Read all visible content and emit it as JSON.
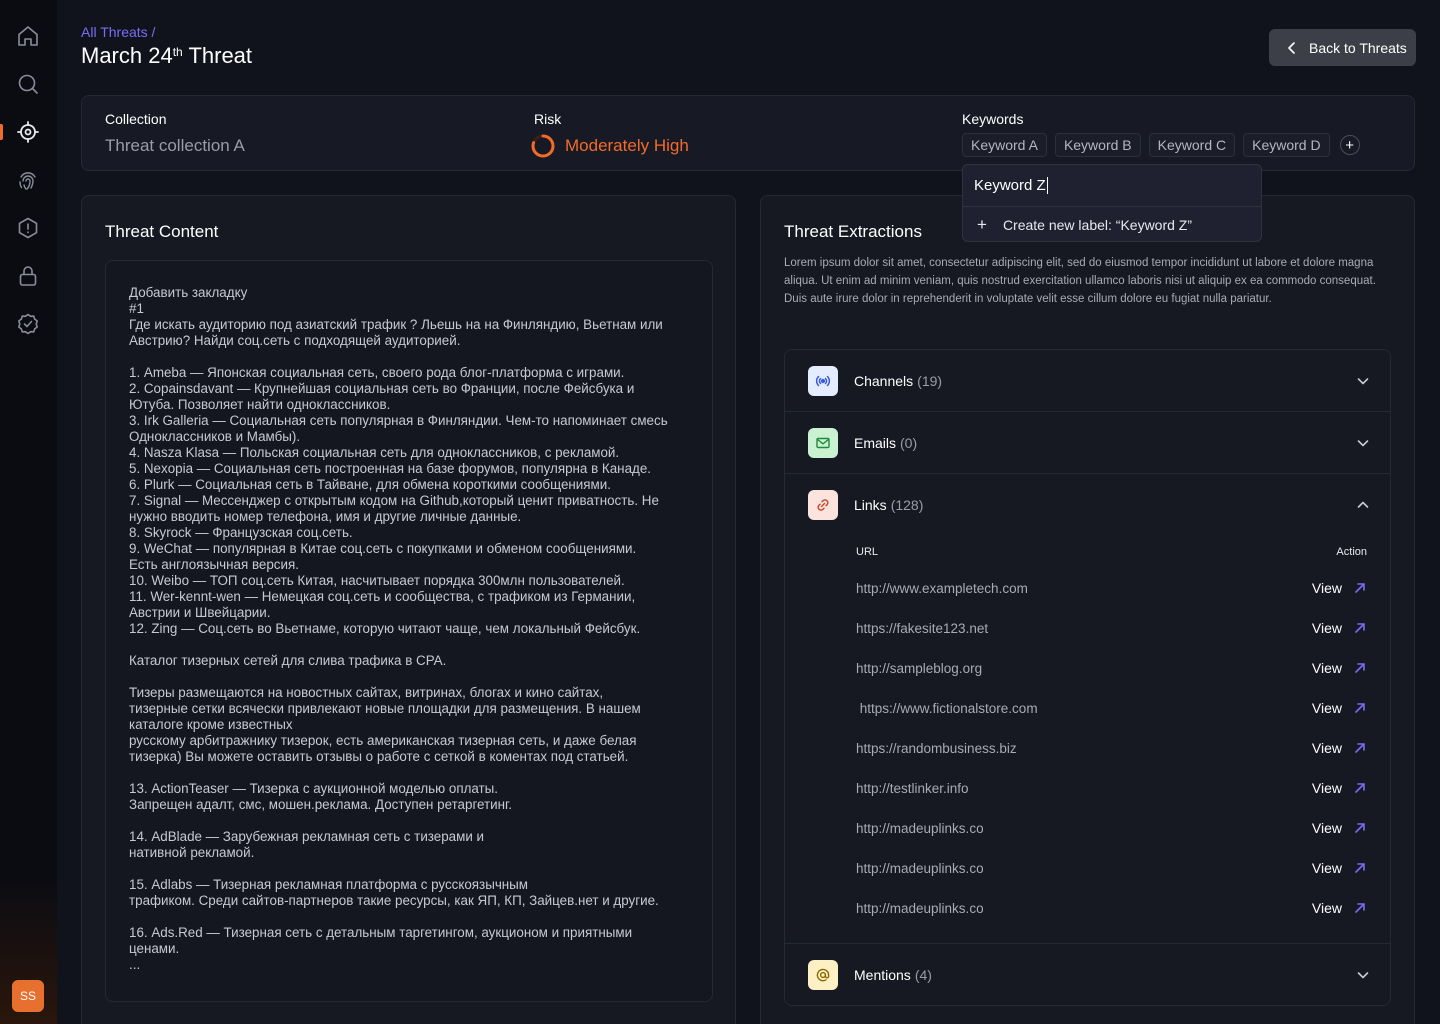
{
  "sidebar": {
    "items": [
      {
        "name": "home-icon"
      },
      {
        "name": "search-icon"
      },
      {
        "name": "target-icon",
        "active": true
      },
      {
        "name": "fingerprint-icon"
      },
      {
        "name": "alert-hexagon-icon"
      },
      {
        "name": "lock-icon"
      },
      {
        "name": "badge-check-icon"
      }
    ],
    "avatar_initials": "SS",
    "accent_color": "#f26b2a"
  },
  "header": {
    "breadcrumb": "All Threats /",
    "title_prefix": "March 24",
    "title_sup": "th",
    "title_suffix": " Threat",
    "back_button": "Back to Threats"
  },
  "info": {
    "collection_label": "Collection",
    "collection_value": "Threat collection A",
    "risk_label": "Risk",
    "risk_value": "Moderately High",
    "risk_level": 0.8,
    "risk_color": "#f26b2a",
    "keywords_label": "Keywords",
    "keywords": [
      "Keyword A",
      "Keyword B",
      "Keyword C",
      "Keyword D"
    ],
    "add_keyword": "+"
  },
  "keyword_dropdown": {
    "input_value": "Keyword Z",
    "create_label": "Create new label: “Keyword Z”"
  },
  "threat_content": {
    "title": "Threat Content",
    "text": "Добавить закладку\n#1\nГде искать аудиторию под азиатский трафик ? Льешь на на Финляндию, Вьетнам или\nАвстрию? Найди соц.сеть с подходящей аудиторией.\n\n1. Ameba — Японская социальная сеть, своего рода блог-платформа с играми.\n2. Copainsdavant — Крупнейшая социальная сеть во Франции, после Фейсбука и\nЮтуба. Позволяет найти одноклассников.\n3. Irk Galleria — Социальная сеть популярная в Финляндии. Чем-то напоминает смесь\nОдноклассников и Мамбы).\n4. Nasza Klasa — Польская социальная сеть для одноклассников, с рекламой.\n5. Nexopia — Социальная сеть построенная на базе форумов, популярна в Канаде.\n6. Plurk — Социальная сеть в Тайване, для обмена короткими сообщениями.\n7. Signal — Мессенджер с открытым кодом на Github,который ценит приватность. Не\nнужно вводить номер телефона, имя и другие личные данные.\n8. Skyrock — Французская соц.сеть.\n9. WeChat — популярная в Китае соц.сеть с покупками и обменом сообщениями.\nЕсть англоязычная версия.\n10. Weibo — ТОП соц.сеть Китая, насчитывает порядка 300млн пользователей.\n11. Wer-kennt-wen — Немецкая соц.сеть и сообщества, с трафиком из Германии,\nАвстрии и Швейцарии.\n12. Zing — Соц.сеть во Вьетнаме, которую читают чаще, чем локальный Фейсбук.\n\nКаталог тизерных сетей для слива трафика в CPA.\n\nТизеры размещаются на новостных сайтах, витринах, блогах и кино сайтах,\nтизерные сетки всячески привлекают новые площадки для размещения. В нашем\nкаталоге кроме известных\nрусскому арбитражнику тизерок, есть американская тизерная сеть, и даже белая\nтизерка) Вы можете оставить отзывы о работе с сеткой в коментах под статьей.\n\n13. ActionTeaser — Тизерка с аукционной моделью оплаты.\nЗапрещен адалт, смс, мошен.реклама. Доступен ретаргетинг.\n\n14. AdBlade — Зарубежная рекламная сеть с тизерами и\nнативной рекламой.\n\n15. Adlabs — Тизерная рекламная платформа с русскоязычным\nтрафиком. Среди сайтов-партнеров такие ресурсы, как ЯП, КП, Зайцев.нет и другие.\n\n16. Ads.Red — Тизерная сеть с детальным таргетингом, аукционом и приятными\nценами.\n..."
  },
  "extractions": {
    "title": "Threat Extractions",
    "description": "Lorem ipsum dolor sit amet, consectetur adipiscing elit, sed do eiusmod tempor incididunt ut labore et dolore magna aliqua. Ut enim ad minim veniam, quis nostrud exercitation ullamco laboris nisi ut aliquip ex ea commodo consequat. Duis aute irure dolor in reprehenderit in voluptate velit esse cillum dolore eu fugiat nulla pariatur.",
    "sections": {
      "channels": {
        "label": "Channels",
        "count": "(19)",
        "icon": "broadcast-icon",
        "icon_bg": "#e6ecff",
        "icon_color": "#3b5bdb"
      },
      "emails": {
        "label": "Emails",
        "count": "(0)",
        "icon": "mail-icon",
        "icon_bg": "#c9f2d2",
        "icon_color": "#1f8a3a"
      },
      "links": {
        "label": "Links",
        "count": "(128)",
        "icon": "link-icon",
        "icon_bg": "#fde3dd",
        "icon_color": "#c4432b"
      },
      "mentions": {
        "label": "Mentions",
        "count": "(4)",
        "icon": "at-icon",
        "icon_bg": "#fdf0c4",
        "icon_color": "#8a6a00"
      }
    },
    "links_table": {
      "col_url": "URL",
      "col_action": "Action",
      "view_label": "View",
      "rows": [
        "http://www.exampletech.com",
        "https://fakesite123.net",
        "http://sampleblog.org",
        " https://www.fictionalstore.com",
        "https://randombusiness.biz",
        "http://testlinker.info",
        "http://madeuplinks.co",
        "http://madeuplinks.co",
        "http://madeuplinks.co"
      ]
    }
  }
}
